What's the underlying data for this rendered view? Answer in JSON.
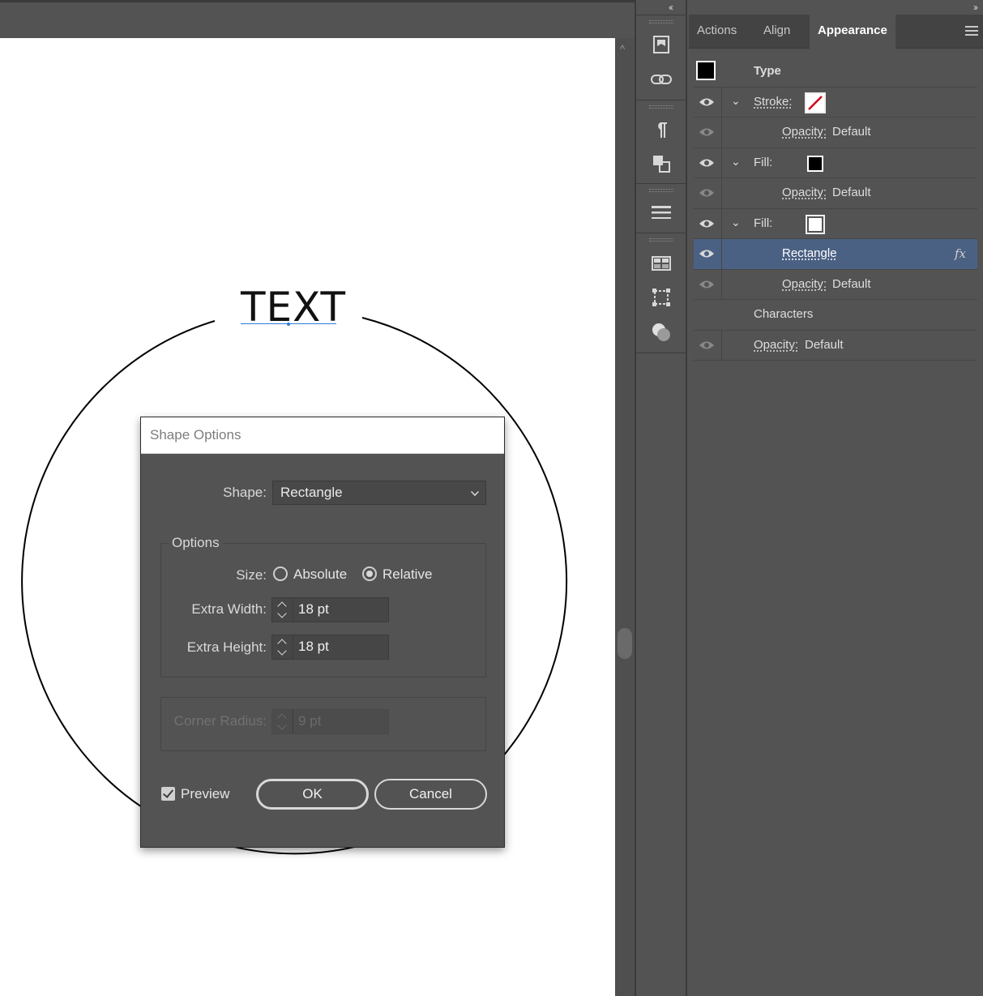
{
  "artwork": {
    "text": "TEXT"
  },
  "dialog": {
    "title": "Shape Options",
    "shape_label": "Shape:",
    "shape_value": "Rectangle",
    "options_legend": "Options",
    "size_label": "Size:",
    "size_absolute": "Absolute",
    "size_relative": "Relative",
    "size_selected": "Relative",
    "extra_width_label": "Extra Width:",
    "extra_width_value": "18 pt",
    "extra_height_label": "Extra Height:",
    "extra_height_value": "18 pt",
    "corner_radius_label": "Corner Radius:",
    "corner_radius_value": "9 pt",
    "preview_label": "Preview",
    "preview_checked": true,
    "ok_label": "OK",
    "cancel_label": "Cancel"
  },
  "panel": {
    "tabs": [
      "Actions",
      "Align",
      "Appearance"
    ],
    "active_tab": "Appearance",
    "header_label": "Type",
    "rows": [
      {
        "label": "Stroke:",
        "value": ""
      },
      {
        "label": "Opacity:",
        "value": "Default"
      },
      {
        "label": "Fill:",
        "value": ""
      },
      {
        "label": "Opacity:",
        "value": "Default"
      },
      {
        "label": "Fill:",
        "value": ""
      },
      {
        "label": "Rectangle",
        "value": "fx"
      },
      {
        "label": "Opacity:",
        "value": "Default"
      },
      {
        "label": "Characters",
        "value": ""
      },
      {
        "label": "Opacity:",
        "value": "Default"
      }
    ]
  },
  "colors": {
    "selection": "#4b6184",
    "panel_bg": "#535353",
    "stroke_none_slash": "#d0021b"
  },
  "icons": [
    "collapse-arrows-icon",
    "expand-arrows-icon",
    "panel-menu-icon",
    "eye-icon",
    "chevron-down-icon",
    "fx-icon",
    "scroll-up-icon"
  ]
}
